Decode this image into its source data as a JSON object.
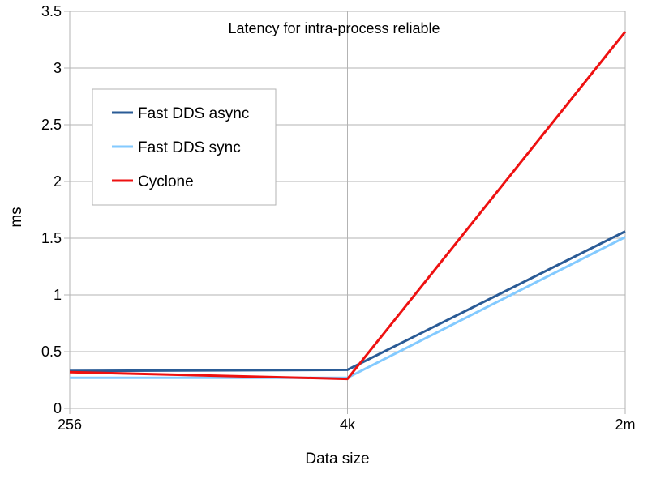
{
  "chart_data": {
    "type": "line",
    "title": "Latency for intra-process reliable",
    "xlabel": "Data size",
    "ylabel": "ms",
    "categories": [
      "256",
      "4k",
      "2m"
    ],
    "ylim": [
      0,
      3.5
    ],
    "yticks": [
      0,
      0.5,
      1,
      1.5,
      2,
      2.5,
      3,
      3.5
    ],
    "ytick_labels": [
      "0",
      "0.5",
      "1",
      "1.5",
      "2",
      "2.5",
      "3",
      "3.5"
    ],
    "grid": true,
    "legend_position": "top-left",
    "series": [
      {
        "name": "Fast DDS async",
        "color": "#2a5b96",
        "values": [
          0.33,
          0.34,
          1.56
        ]
      },
      {
        "name": "Fast DDS sync",
        "color": "#83caff",
        "values": [
          0.27,
          0.27,
          1.51
        ]
      },
      {
        "name": "Cyclone",
        "color": "#ee1111",
        "values": [
          0.32,
          0.26,
          3.32
        ]
      }
    ]
  }
}
